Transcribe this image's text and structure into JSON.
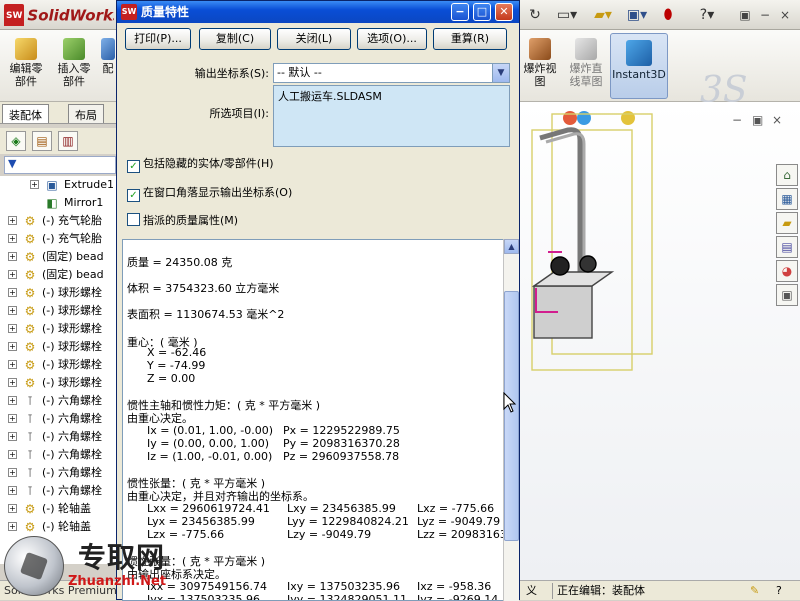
{
  "app": {
    "logo_text": "SolidWorks",
    "logo_badge": "SW",
    "window_controls": [
      "▣",
      "−",
      "×"
    ]
  },
  "command_manager": {
    "buttons": [
      {
        "label": "编辑零部件"
      },
      {
        "label": "插入零部件"
      },
      {
        "label": "配"
      },
      {
        "label": "爆炸视图"
      },
      {
        "label": "爆炸直线草图"
      }
    ],
    "instant3d_label": "Instant3D",
    "logo_mark": "3S"
  },
  "feature_manager": {
    "tabs": [
      "装配体",
      "布局"
    ],
    "filter_icon": "▼",
    "tree": [
      {
        "expand": "+",
        "icon": "solid-icon",
        "text": "Extrude1",
        "indent": 1
      },
      {
        "expand": "",
        "icon": "mirror-icon",
        "text": "Mirror1",
        "indent": 1
      },
      {
        "expand": "+",
        "icon": "part-icon",
        "text": "(-) 充气轮胎",
        "indent": 0
      },
      {
        "expand": "+",
        "icon": "part-icon",
        "text": "(-) 充气轮胎",
        "indent": 0
      },
      {
        "expand": "+",
        "icon": "part-icon",
        "text": "(固定) bead",
        "indent": 0
      },
      {
        "expand": "+",
        "icon": "part-icon",
        "text": "(固定) bead",
        "indent": 0
      },
      {
        "expand": "+",
        "icon": "part-icon",
        "text": "(-) 球形螺栓",
        "indent": 0
      },
      {
        "expand": "+",
        "icon": "part-icon",
        "text": "(-) 球形螺栓",
        "indent": 0
      },
      {
        "expand": "+",
        "icon": "part-icon",
        "text": "(-) 球形螺栓",
        "indent": 0
      },
      {
        "expand": "+",
        "icon": "part-icon",
        "text": "(-) 球形螺栓",
        "indent": 0
      },
      {
        "expand": "+",
        "icon": "part-icon",
        "text": "(-) 球形螺栓",
        "indent": 0
      },
      {
        "expand": "+",
        "icon": "part-icon",
        "text": "(-) 球形螺栓",
        "indent": 0
      },
      {
        "expand": "+",
        "icon": "bolt-icon",
        "text": "(-) 六角螺栓",
        "indent": 0
      },
      {
        "expand": "+",
        "icon": "bolt-icon",
        "text": "(-) 六角螺栓",
        "indent": 0
      },
      {
        "expand": "+",
        "icon": "bolt-icon",
        "text": "(-) 六角螺栓",
        "indent": 0
      },
      {
        "expand": "+",
        "icon": "bolt-icon",
        "text": "(-) 六角螺栓",
        "indent": 0
      },
      {
        "expand": "+",
        "icon": "bolt-icon",
        "text": "(-) 六角螺栓",
        "indent": 0
      },
      {
        "expand": "+",
        "icon": "bolt-icon",
        "text": "(-) 六角螺栓",
        "indent": 0
      },
      {
        "expand": "+",
        "icon": "part-icon",
        "text": "(-) 轮轴盖",
        "indent": 0
      },
      {
        "expand": "+",
        "icon": "part-icon",
        "text": "(-) 轮轴盖",
        "indent": 0
      }
    ]
  },
  "dialog": {
    "title": "质量特性",
    "title_badge": "SW",
    "buttons": [
      "打印(P)...",
      "复制(C)",
      "关闭(L)",
      "选项(O)...",
      "重算(R)"
    ],
    "coord_label": "输出坐标系(S):",
    "coord_value": "-- 默认 --",
    "selected_label": "所选项目(I):",
    "selected_item": "人工搬运车.SLDASM",
    "checkboxes": [
      {
        "label": "包括隐藏的实体/零部件(H)",
        "checked": true,
        "mark": "✓"
      },
      {
        "label": "在窗口角落显示输出坐标系(O)",
        "checked": true,
        "mark": "✓"
      },
      {
        "label": "指派的质量属性(M)",
        "checked": false,
        "mark": ""
      }
    ],
    "results": {
      "mass": "质量 = 24350.08 克",
      "volume": "体积 = 3754323.60 立方毫米",
      "area": "表面积 = 1130674.53 毫米^2",
      "com_title": "重心：( 毫米 )",
      "com": [
        "X = -62.46",
        "Y = -74.99",
        "Z = 0.00"
      ],
      "principal_title": "惯性主轴和惯性力矩：( 克 * 平方毫米 )",
      "principal_sub": "由重心决定。",
      "principal_axes": [
        "Ix = (0.01, 1.00, -0.00)",
        "Iy = (0.00, 0.00, 1.00)",
        "Iz = (1.00, -0.01, 0.00)"
      ],
      "principal_moments": [
        "Px = 1229522989.75",
        "Py = 2098316370.28",
        "Pz = 2960937558.78"
      ],
      "tensor_title": "惯性张量：( 克 * 平方毫米 )",
      "tensor_sub": "由重心决定，并且对齐输出的坐标系。",
      "tensor": [
        [
          "Lxx = 2960619724.41",
          "Lxy = 23456385.99",
          "Lxz = -775.66"
        ],
        [
          "Lyx = 23456385.99",
          "Lyy = 1229840824.21",
          "Lyz = -9049.79"
        ],
        [
          "Lzx = -775.66",
          "Lzy = -9049.79",
          "Lzz = 209831637"
        ]
      ],
      "tensor2_title": "惯性张量：( 克 * 平方毫米 )",
      "tensor2_sub": "由输出座标系决定。",
      "tensor2": [
        [
          "Ixx = 3097549156.74",
          "Ixy = 137503235.96",
          "Ixz = -958.36"
        ],
        [
          "Iyx = 137503235.96",
          "Iyy = 1324829051.11",
          "Iyz = -9269.14"
        ]
      ]
    }
  },
  "status_bar": {
    "left_text": "SolidWorks Premium",
    "mid_text": "义",
    "editing": "正在编辑：装配体",
    "help": "?"
  },
  "watermark": {
    "cn": "专取网",
    "en": "Zhuanzhi.Net"
  },
  "colors": {
    "xp_blue": "#0a4ed6",
    "result_bg": "#ffffff",
    "sel_bg": "#cfe6f5",
    "check_green": "#21a121"
  }
}
